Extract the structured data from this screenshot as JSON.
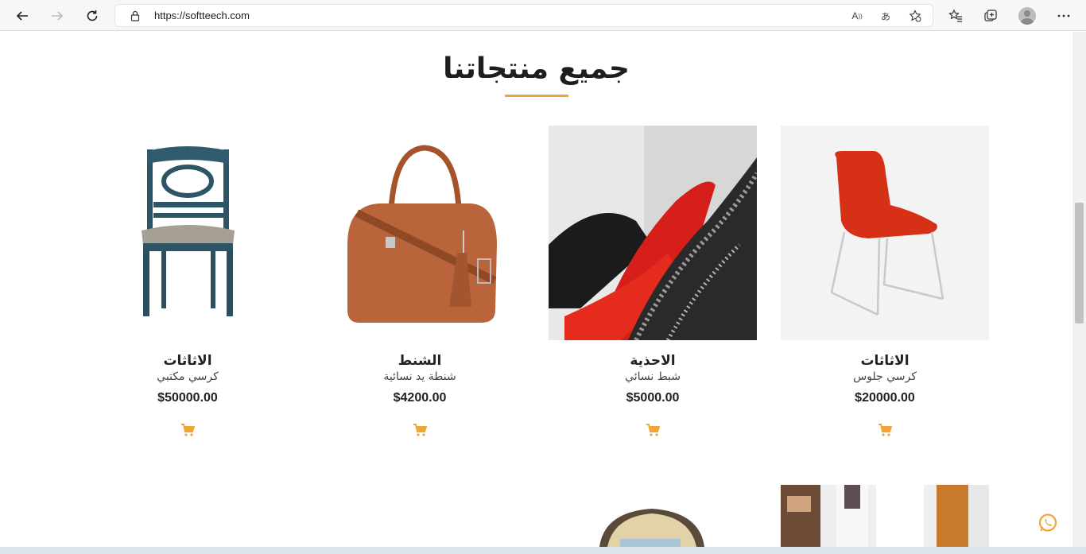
{
  "browser": {
    "url": "https://softteech.com",
    "read_aloud_label": "A",
    "translate_label": "あ"
  },
  "section": {
    "title": "جميع منتجاتنا"
  },
  "products": [
    {
      "category": "الاثاثات",
      "name": "كرسي مكتبي",
      "price": "$50000.00",
      "image": "teal-wooden-chair"
    },
    {
      "category": "الشنط",
      "name": "شنطة يد نسائية",
      "price": "$4200.00",
      "image": "brown-leather-handbag"
    },
    {
      "category": "الاحذية",
      "name": "شبط نسائي",
      "price": "$5000.00",
      "image": "red-heels-shoes"
    },
    {
      "category": "الاثاثات",
      "name": "كرسي جلوس",
      "price": "$20000.00",
      "image": "red-lounge-chair"
    }
  ],
  "colors": {
    "accent": "#f0a43a",
    "heading": "#1e1e1e",
    "whatsapp": "#f0a43a"
  }
}
